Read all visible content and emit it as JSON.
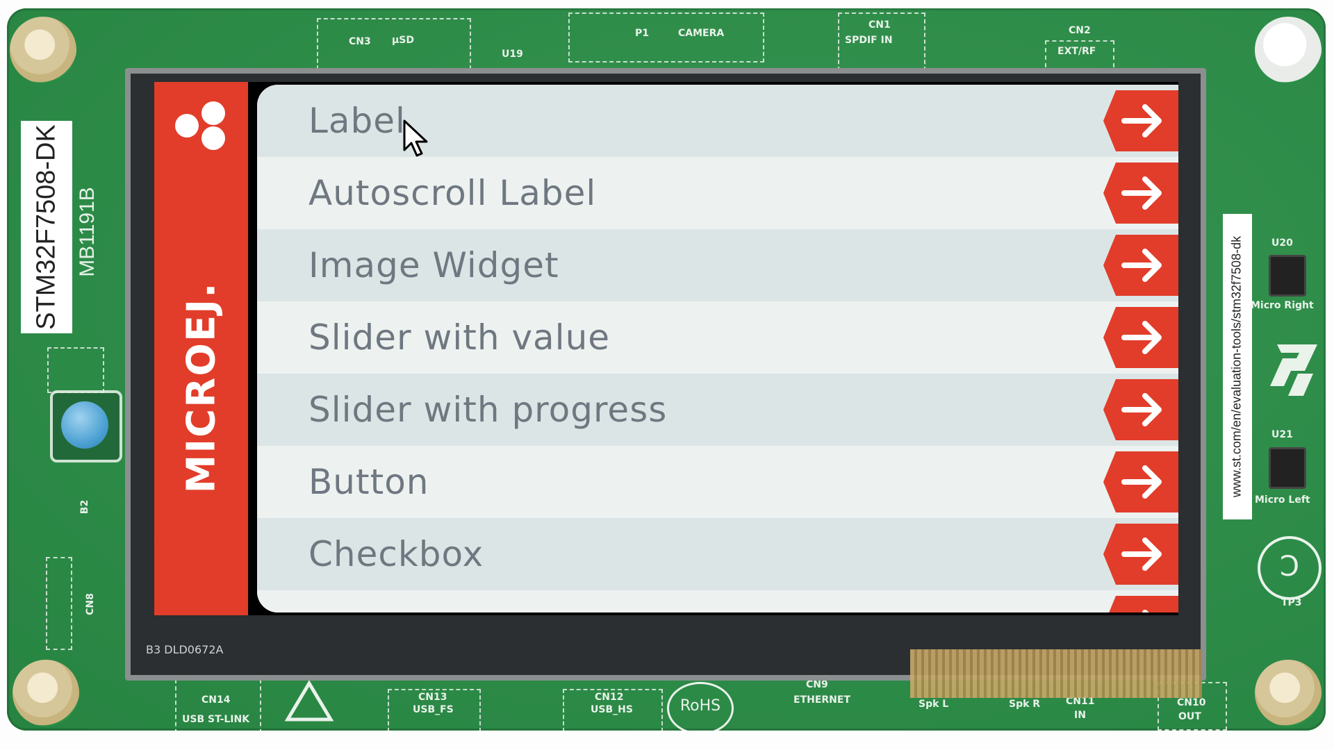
{
  "board": {
    "part_number": "STM32F7508-DK",
    "board_id": "MB1191B",
    "url_text": "www.st.com/en/evaluation-tools/stm32f7508-dk",
    "silkscreen": {
      "cn3": "CN3",
      "usd": "µSD",
      "u19": "U19",
      "p1": "P1",
      "camera": "CAMERA",
      "cn1": "CN1",
      "spdif_in": "SPDIF IN",
      "cn2": "CN2",
      "ext_rf": "EXT/RF",
      "u20": "U20",
      "micro_right": "Micro Right",
      "u21": "U21",
      "micro_left": "Micro Left",
      "tp3": "TP3",
      "cn14": "CN14",
      "usb_stlink": "USB ST-LINK",
      "cn13": "CN13",
      "usb_fs": "USB_FS",
      "cn12": "CN12",
      "usb_hs": "USB_HS",
      "rohs": "RoHS",
      "cn9": "CN9",
      "ethernet": "ETHERNET",
      "spk_l": "Spk L",
      "spk_r": "Spk R",
      "cn11": "CN11",
      "in": "IN",
      "cn10": "CN10",
      "out": "OUT",
      "display_code": "B3 DLD0672A",
      "cn8": "CN8",
      "b2": "B2"
    }
  },
  "app": {
    "brand": "MICROEJ.",
    "brand_color": "#e23d2a",
    "menu_items": [
      {
        "label": "Label"
      },
      {
        "label": "Autoscroll Label"
      },
      {
        "label": "Image Widget"
      },
      {
        "label": "Slider with value"
      },
      {
        "label": "Slider with progress"
      },
      {
        "label": "Button"
      },
      {
        "label": "Checkbox"
      }
    ],
    "arrow_icon": "arrow-right-icon"
  }
}
